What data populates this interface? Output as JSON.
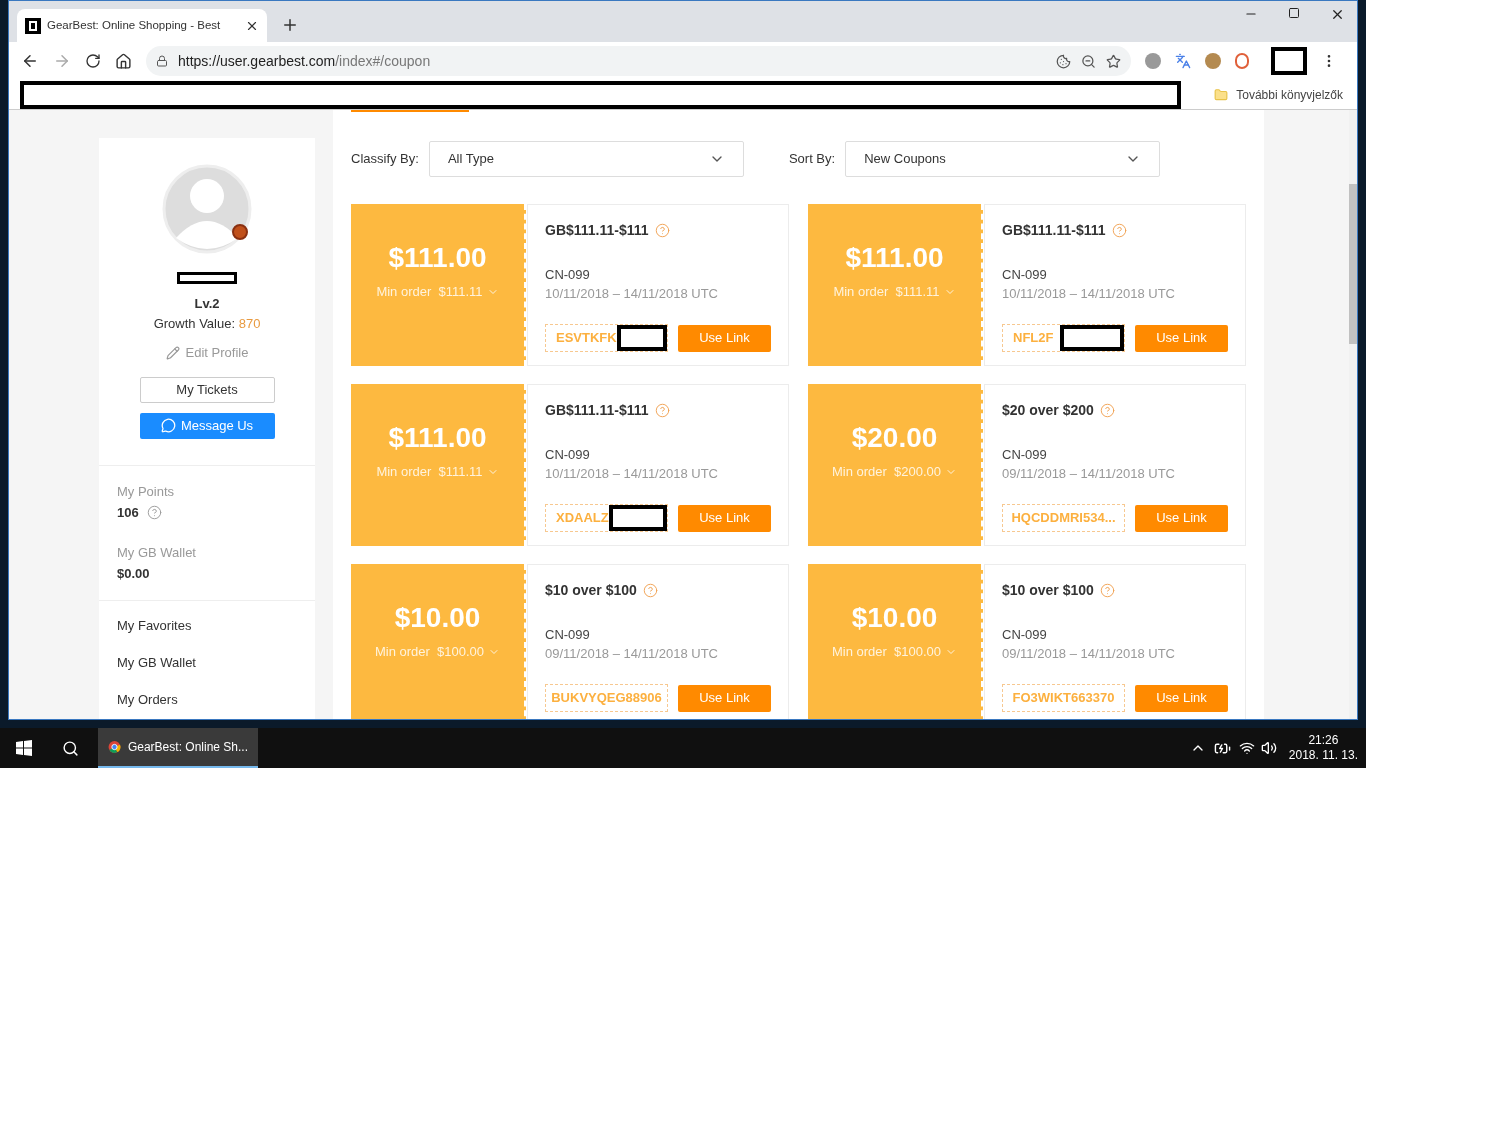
{
  "browser": {
    "tab_title": "GearBest: Online Shopping - Best",
    "url_host": "https://user.gearbest.com",
    "url_path": "/index#/coupon",
    "bookmarks_folder": "További könyvjelzők"
  },
  "sidebar": {
    "level": "Lv.2",
    "growth_label": "Growth Value:",
    "growth_value": "870",
    "edit_profile": "Edit Profile",
    "tickets_button": "My Tickets",
    "message_button": "Message Us",
    "points_label": "My Points",
    "points": "106",
    "wallet_label": "My GB Wallet",
    "wallet": "$0.00",
    "nav": [
      "My Favorites",
      "My GB Wallet",
      "My Orders"
    ]
  },
  "filters": {
    "classify_label": "Classify By:",
    "classify_value": "All Type",
    "sort_label": "Sort By:",
    "sort_value": "New Coupons"
  },
  "coupons": [
    {
      "amount": "$111.00",
      "min_order": "Min order  $111.11",
      "title": "GB$111.11-$111",
      "region": "CN-099",
      "dates": "10/11/2018 – 14/11/2018 UTC",
      "code": "ESVTKFK",
      "redacted": true,
      "button": "Use Link"
    },
    {
      "amount": "$111.00",
      "min_order": "Min order  $111.11",
      "title": "GB$111.11-$111",
      "region": "CN-099",
      "dates": "10/11/2018 – 14/11/2018 UTC",
      "code": "NFL2F",
      "redacted": true,
      "button": "Use Link"
    },
    {
      "amount": "$111.00",
      "min_order": "Min order  $111.11",
      "title": "GB$111.11-$111",
      "region": "CN-099",
      "dates": "10/11/2018 – 14/11/2018 UTC",
      "code": "XDAALZ",
      "redacted": true,
      "button": "Use Link"
    },
    {
      "amount": "$20.00",
      "min_order": "Min order  $200.00",
      "title": "$20 over $200",
      "region": "CN-099",
      "dates": "09/11/2018 – 14/11/2018 UTC",
      "code": "HQCDDMRI534...",
      "redacted": false,
      "button": "Use Link"
    },
    {
      "amount": "$10.00",
      "min_order": "Min order  $100.00",
      "title": "$10 over $100",
      "region": "CN-099",
      "dates": "09/11/2018 – 14/11/2018 UTC",
      "code": "BUKVYQEG88906",
      "redacted": false,
      "button": "Use Link"
    },
    {
      "amount": "$10.00",
      "min_order": "Min order  $100.00",
      "title": "$10 over $100",
      "region": "CN-099",
      "dates": "09/11/2018 – 14/11/2018 UTC",
      "code": "FO3WIKT663370",
      "redacted": false,
      "button": "Use Link"
    }
  ],
  "taskbar": {
    "app_title": "GearBest: Online Sh...",
    "time": "21:26",
    "date": "2018. 11. 13."
  }
}
